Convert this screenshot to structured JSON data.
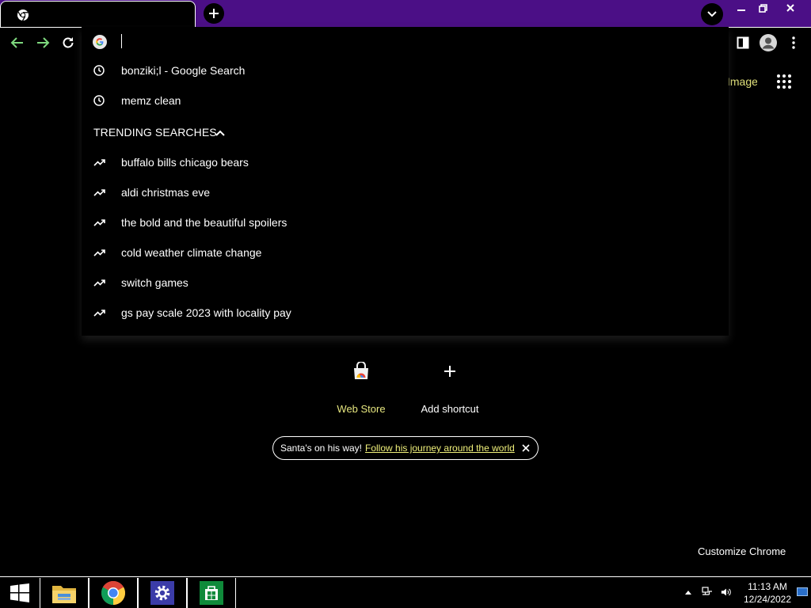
{
  "browser": {
    "tab_title": "",
    "omnibox_value": ""
  },
  "omnibox": {
    "history": [
      {
        "icon": "history-clock-icon",
        "text": "bonziki;l - Google Search"
      },
      {
        "icon": "history-clock-icon",
        "text": "memz clean"
      }
    ],
    "trending_header": "TRENDING SEARCHES",
    "trending": [
      {
        "icon": "trending-arrow-icon",
        "text": "buffalo bills chicago bears"
      },
      {
        "icon": "trending-arrow-icon",
        "text": "aldi christmas eve"
      },
      {
        "icon": "trending-arrow-icon",
        "text": "the bold and the beautiful spoilers"
      },
      {
        "icon": "trending-arrow-icon",
        "text": "cold weather climate change"
      },
      {
        "icon": "trending-arrow-icon",
        "text": "switch games"
      },
      {
        "icon": "trending-arrow-icon",
        "text": "gs pay scale 2023 with locality pay"
      }
    ]
  },
  "ntp": {
    "images_link": "Images",
    "shortcuts": [
      {
        "label": "Web Store",
        "icon": "web-store-icon"
      },
      {
        "label": "Add shortcut",
        "icon": "plus-icon"
      }
    ],
    "promo_text": "Santa's on his way!",
    "promo_link": "Follow his journey around the world",
    "customize_label": "Customize Chrome"
  },
  "taskbar": {
    "apps": [
      "file-explorer-icon",
      "chrome-icon",
      "settings-icon",
      "store-icon"
    ],
    "time": "11:13 AM",
    "date": "12/24/2022"
  },
  "colors": {
    "titlebar": "#4b0f86",
    "nav_green": "#7ed87e",
    "link_yellow": "#f0f07a",
    "background": "#000000"
  }
}
